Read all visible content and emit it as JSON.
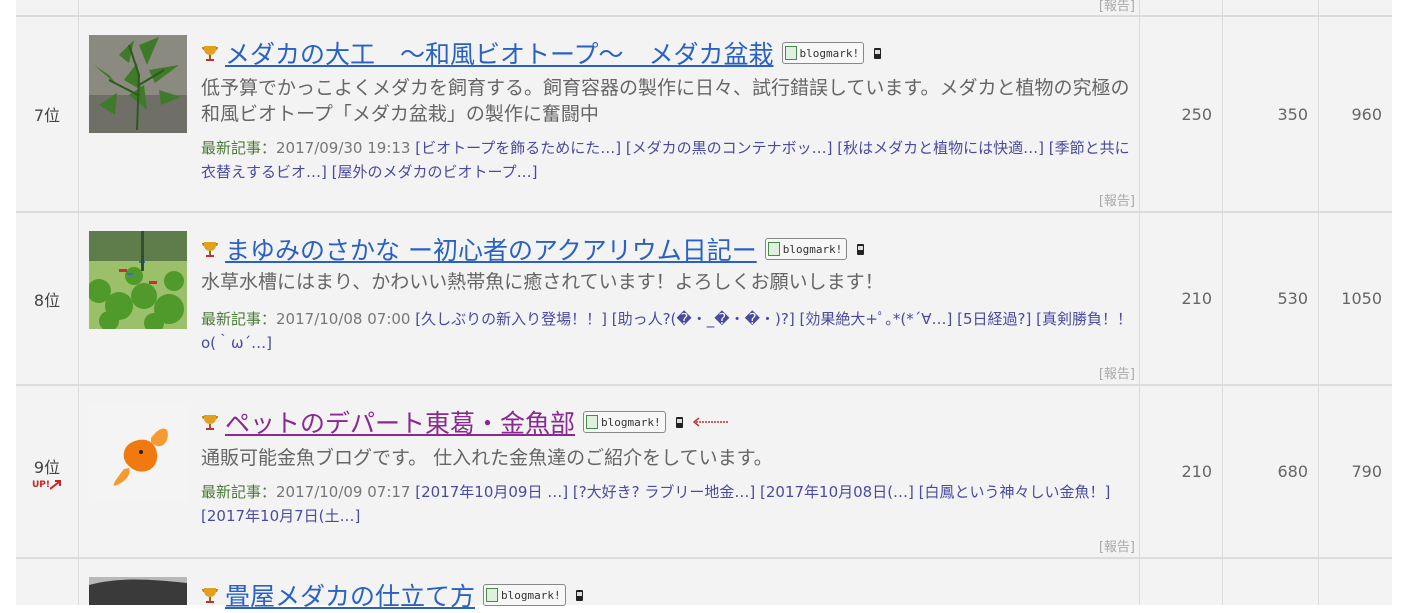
{
  "rows": [
    {
      "rank": "",
      "report": "[報告]"
    },
    {
      "rank": "7位",
      "title": "メダカの大工　～和風ビオトープ～　メダカ盆栽",
      "blogmark": "blogmark!",
      "desc": "低予算でかっこよくメダカを飼育する。飼育容器の製作に日々、試行錯誤しています。メダカと植物の究極の和風ビオトープ「メダカ盆栽」の製作に奮闘中",
      "recent_label": "最新記事：",
      "recent_date": "2017/09/30 19:13",
      "recent_links": "[ビオトープを飾るためにた…] [メダカの黒のコンテナボッ…] [秋はメダカと植物には快適…] [季節と共に衣替えするビオ…] [屋外のメダカのビオトープ…]",
      "report": "[報告]",
      "n1": "250",
      "n2": "350",
      "n3": "960"
    },
    {
      "rank": "8位",
      "title": "まゆみのさかな ー初心者のアクアリウム日記ー",
      "blogmark": "blogmark!",
      "desc": "水草水槽にはまり、かわいい熱帯魚に癒されています！よろしくお願いします！",
      "recent_label": "最新記事：",
      "recent_date": "2017/10/08 07:00",
      "recent_links": "[久しぶりの新入り登場！！] [助っ人?(�・_�・�・)?] [効果絶大+ﾟ｡*(*´∀…] [5日経過?] [真剣勝負！！o(｀ω´…]",
      "report": "[報告]",
      "n1": "210",
      "n2": "530",
      "n3": "1050"
    },
    {
      "rank": "9位",
      "up": "UP!",
      "title": "ペットのデパート東葛・金魚部",
      "blogmark": "blogmark!",
      "desc": "通販可能金魚ブログです。 仕入れた金魚達のご紹介をしています。",
      "recent_label": "最新記事：",
      "recent_date": "2017/10/09 07:17",
      "recent_links": "[2017年10月09日 …] [?大好き? ラブリー地金…] [2017年10月08日(…] [白鳳という神々しい金魚！] [2017年10月7日(土…]",
      "report": "[報告]",
      "n1": "210",
      "n2": "680",
      "n3": "790"
    },
    {
      "title": "畳屋メダカの仕立て方",
      "blogmark": "blogmark!"
    }
  ]
}
